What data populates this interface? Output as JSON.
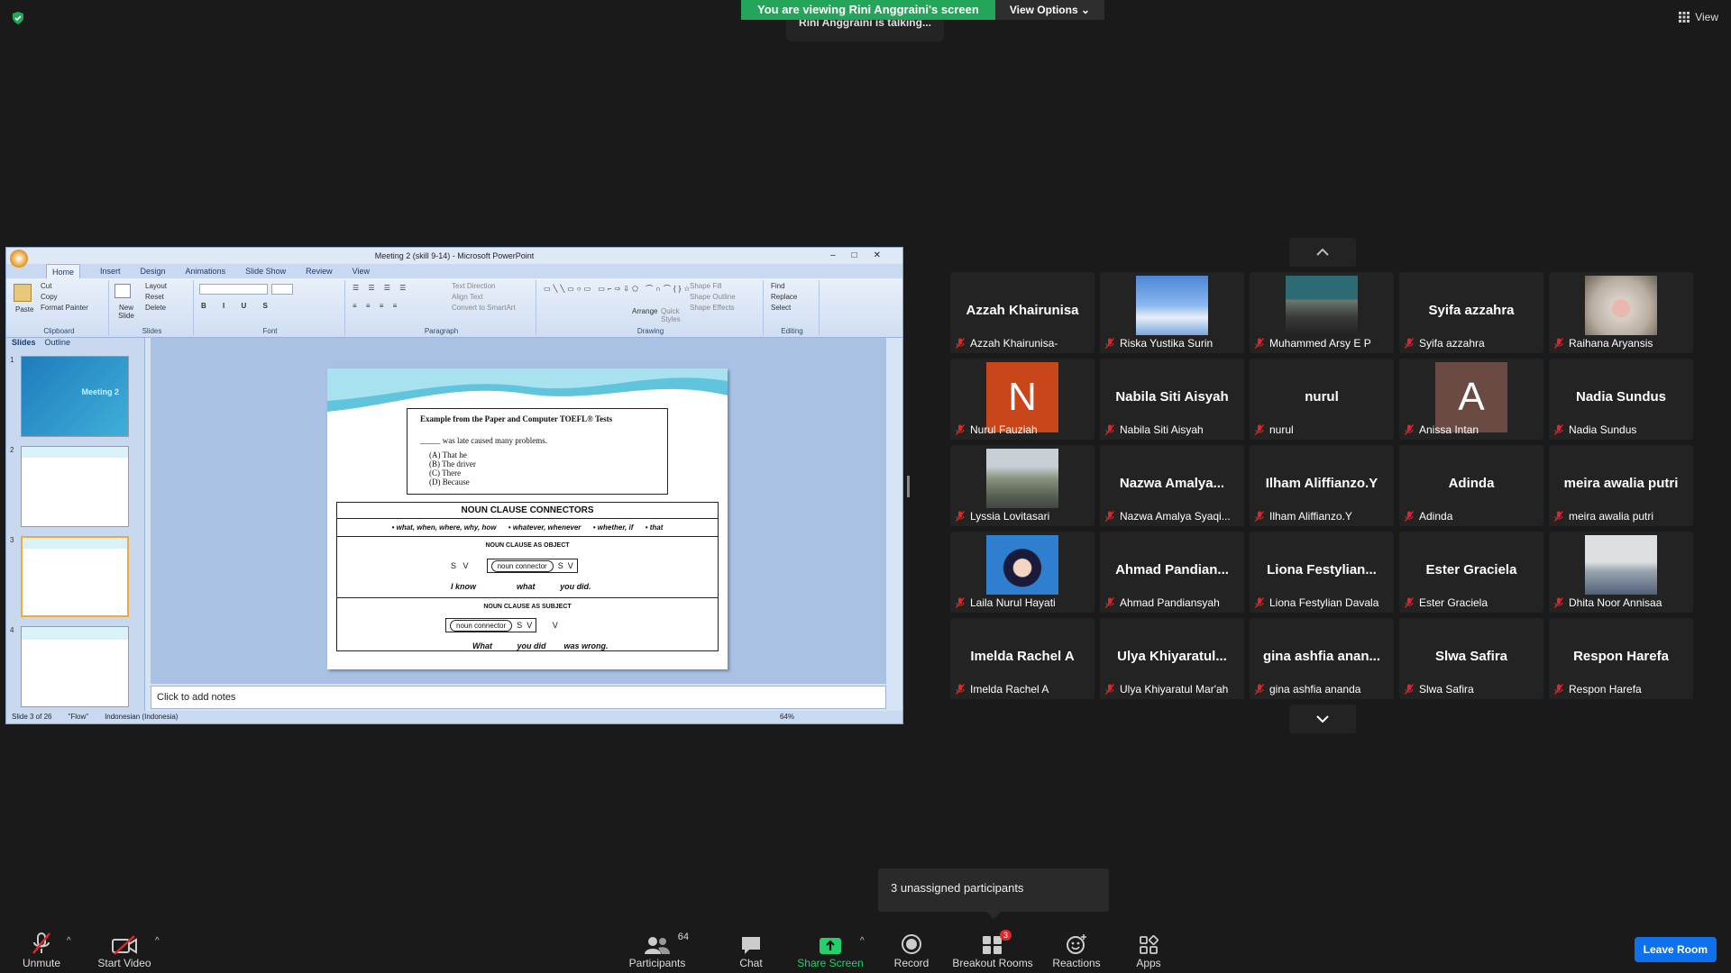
{
  "banner": {
    "viewing": "You are viewing Rini Anggraini's screen",
    "view_options": "View Options",
    "talking": "Rini Anggraini is talking..."
  },
  "top_right": {
    "view": "View"
  },
  "ppt": {
    "title": "Meeting 2 (skill 9-14) - Microsoft PowerPoint",
    "tabs": [
      "Home",
      "Insert",
      "Design",
      "Animations",
      "Slide Show",
      "Review",
      "View"
    ],
    "groups": {
      "clipboard": "Clipboard",
      "slides": "Slides",
      "font": "Font",
      "paragraph": "Paragraph",
      "drawing": "Drawing",
      "editing": "Editing"
    },
    "clipboard_items": {
      "paste": "Paste",
      "cut": "Cut",
      "copy": "Copy",
      "format_painter": "Format Painter"
    },
    "slides_items": {
      "new_slide": "New Slide",
      "layout": "Layout",
      "reset": "Reset",
      "delete": "Delete"
    },
    "paragraph_items": {
      "text_direction": "Text Direction",
      "align_text": "Align Text",
      "convert": "Convert to SmartArt"
    },
    "drawing_items": {
      "arrange": "Arrange",
      "quick_styles": "Quick Styles",
      "shape_fill": "Shape Fill",
      "shape_outline": "Shape Outline",
      "shape_effects": "Shape Effects"
    },
    "editing_items": {
      "find": "Find",
      "replace": "Replace",
      "select": "Select"
    },
    "panel_tabs": {
      "slides": "Slides",
      "outline": "Outline"
    },
    "thumb1_title": "Meeting 2",
    "notes_placeholder": "Click to add notes",
    "status": {
      "slide": "Slide 3 of 26",
      "theme": "\"Flow\"",
      "language": "Indonesian (Indonesia)",
      "zoom": "64%"
    },
    "slide": {
      "box_title": "Example from the Paper and Computer TOEFL® Tests",
      "question": "_____ was late caused many problems.",
      "options": [
        "(A)   That he",
        "(B)   The driver",
        "(C)   There",
        "(D)   Because"
      ],
      "connectors_title": "NOUN CLAUSE CONNECTORS",
      "connectors": [
        "• what, when, where, why, how",
        "• whatever, whenever",
        "• whether, if",
        "• that"
      ],
      "object_label": "NOUN CLAUSE AS OBJECT",
      "subject_label": "NOUN CLAUSE AS SUBJECT",
      "noun_connector": "noun connector",
      "s": "S",
      "v": "V",
      "obj_example": [
        "I know",
        "what",
        "you did."
      ],
      "subj_example": [
        "What",
        "you did",
        "was wrong."
      ]
    }
  },
  "participants": [
    {
      "big": "Azzah Khairunisa",
      "name": "Azzah Khairunisa-"
    },
    {
      "big": "",
      "name": "Riska Yustika Surin",
      "photo": "sky"
    },
    {
      "big": "",
      "name": "Muhammed Arsy E P",
      "photo": "crowd"
    },
    {
      "big": "Syifa azzahra",
      "name": "Syifa azzahra"
    },
    {
      "big": "",
      "name": "Raihana Aryansis",
      "photo": "cat"
    },
    {
      "big": "N",
      "name": "Nurul Fauziah",
      "avatar": "#c8461a"
    },
    {
      "big": "Nabila Siti Aisyah",
      "name": "Nabila Siti Aisyah"
    },
    {
      "big": "nurul",
      "name": "nurul"
    },
    {
      "big": "A",
      "name": "Anissa Intan",
      "avatar": "#6b4a43"
    },
    {
      "big": "Nadia Sundus",
      "name": "Nadia Sundus"
    },
    {
      "big": "",
      "name": "Lyssia Lovitasari",
      "photo": "street"
    },
    {
      "big": "Nazwa Amalya...",
      "name": "Nazwa Amalya Syaqi..."
    },
    {
      "big": "Ilham Aliffianzo.Y",
      "name": "Ilham Aliffianzo.Y"
    },
    {
      "big": "Adinda",
      "name": "Adinda"
    },
    {
      "big": "meira awalia putri",
      "name": "meira awalia putri"
    },
    {
      "big": "",
      "name": "Laila Nurul Hayati",
      "photo": "hijab"
    },
    {
      "big": "Ahmad Pandian...",
      "name": "Ahmad Pandiansyah"
    },
    {
      "big": "Liona Festylian...",
      "name": "Liona Festylian Davala"
    },
    {
      "big": "Ester Graciela",
      "name": "Ester Graciela"
    },
    {
      "big": "",
      "name": "Dhita Noor Annisaa",
      "photo": "stage"
    },
    {
      "big": "Imelda Rachel A",
      "name": "Imelda Rachel A"
    },
    {
      "big": "Ulya Khiyaratul...",
      "name": "Ulya Khiyaratul Mar'ah"
    },
    {
      "big": "gina ashfia anan...",
      "name": "gina ashfia ananda"
    },
    {
      "big": "Slwa Safira",
      "name": "Slwa Safira"
    },
    {
      "big": "Respon Harefa",
      "name": "Respon Harefa"
    }
  ],
  "unassigned": "3 unassigned participants",
  "toolbar": {
    "unmute": "Unmute",
    "start_video": "Start Video",
    "participants": "Participants",
    "participants_count": "64",
    "chat": "Chat",
    "share_screen": "Share Screen",
    "record": "Record",
    "breakout": "Breakout Rooms",
    "breakout_badge": "3",
    "reactions": "Reactions",
    "apps": "Apps",
    "leave": "Leave Room"
  }
}
